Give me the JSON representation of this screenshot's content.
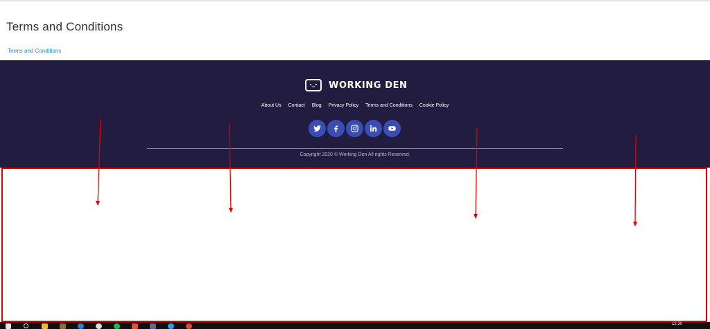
{
  "page": {
    "title": "Terms and Conditions",
    "breadcrumb": "Terms and Conditions"
  },
  "footer": {
    "logo_text": "WORKING DEN",
    "nav": [
      {
        "label": "About Us"
      },
      {
        "label": "Contact"
      },
      {
        "label": "Blog"
      },
      {
        "label": "Privacy Policy"
      },
      {
        "label": "Terms and Conditions"
      },
      {
        "label": "Cookie Policy"
      }
    ],
    "socials": [
      "twitter-icon",
      "facebook-icon",
      "instagram-icon",
      "linkedin-icon",
      "youtube-icon"
    ],
    "copyright": "Copyright 2020 © Working Den All rights Reserved."
  },
  "taskbar": {
    "clock": "12:30"
  },
  "colors": {
    "footer_bg": "#221d40",
    "social_bg": "#3b4db3",
    "link": "#1a8ccf",
    "annotation": "#e00000"
  }
}
